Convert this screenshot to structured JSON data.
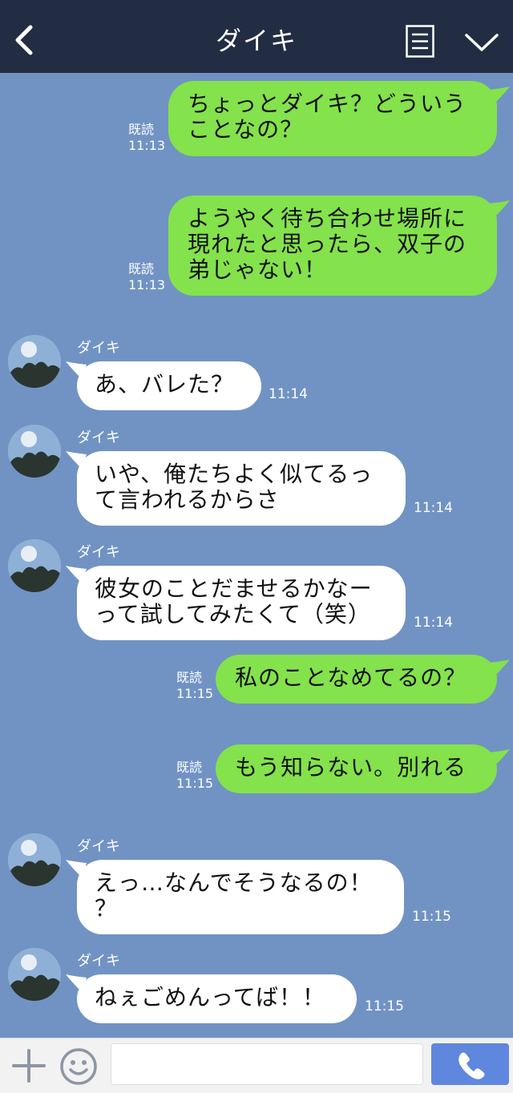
{
  "header": {
    "title": "ダイキ",
    "back_icon": "chevron-left-icon",
    "menu_icon": "list-icon",
    "collapse_icon": "chevron-down-icon"
  },
  "colors": {
    "header_bg": "#222d43",
    "chat_bg": "#7193c3",
    "outgoing_bubble": "#84e24c",
    "incoming_bubble": "#ffffff",
    "call_button": "#5f87de"
  },
  "messages": [
    {
      "direction": "out",
      "lines": [
        "ちょっとダイキ？どういう",
        "ことなの？"
      ],
      "read_label": "既読",
      "time": "11:13"
    },
    {
      "direction": "out",
      "lines": [
        "ようやく待ち合わせ場所に",
        "現れたと思ったら、双子の",
        "弟じゃない！"
      ],
      "read_label": "既読",
      "time": "11:13"
    },
    {
      "direction": "in",
      "sender": "ダイキ",
      "lines": [
        "あ、バレた？"
      ],
      "time": "11:14"
    },
    {
      "direction": "in",
      "sender": "ダイキ",
      "lines": [
        "いや、俺たちよく似てるっ",
        "て言われるからさ"
      ],
      "time": "11:14"
    },
    {
      "direction": "in",
      "sender": "ダイキ",
      "lines": [
        "彼女のことだませるかなー",
        "って試してみたくて（笑）"
      ],
      "time": "11:14"
    },
    {
      "direction": "out",
      "lines": [
        "私のことなめてるの？"
      ],
      "read_label": "既読",
      "time": "11:15"
    },
    {
      "direction": "out",
      "lines": [
        "もう知らない。別れる"
      ],
      "read_label": "既読",
      "time": "11:15"
    },
    {
      "direction": "in",
      "sender": "ダイキ",
      "lines": [
        "えっ…なんでそうなるの！",
        "？"
      ],
      "time": "11:15"
    },
    {
      "direction": "in",
      "sender": "ダイキ",
      "lines": [
        "ねぇごめんってば！！"
      ],
      "time": "11:15"
    }
  ],
  "input_bar": {
    "plus_icon": "plus-icon",
    "emoji_icon": "smiley-icon",
    "input_value": "",
    "input_placeholder": "",
    "call_icon": "phone-icon"
  }
}
